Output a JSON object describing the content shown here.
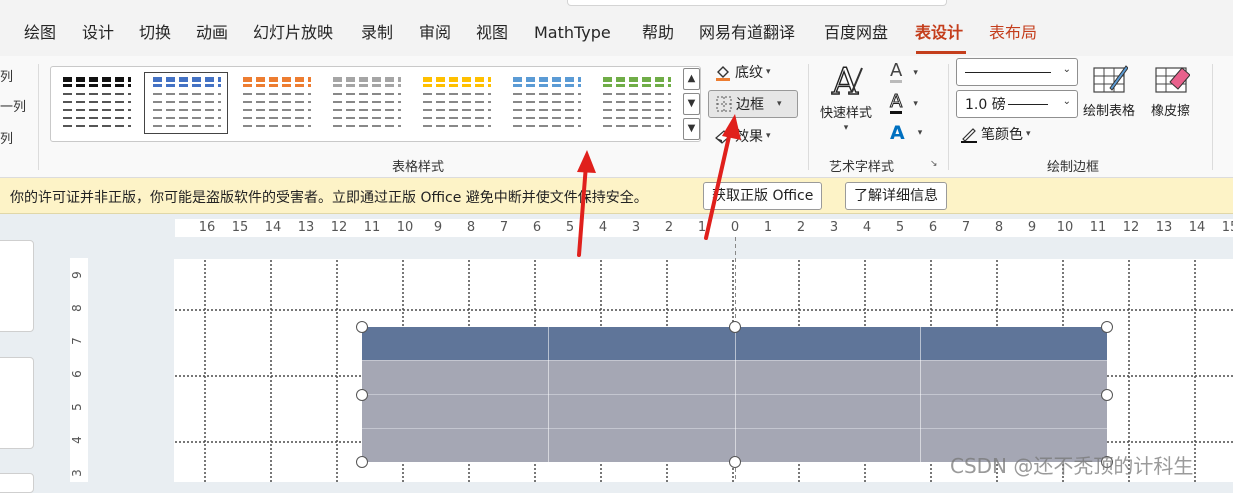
{
  "tabs": [
    {
      "label": "绘图"
    },
    {
      "label": "设计"
    },
    {
      "label": "切换"
    },
    {
      "label": "动画"
    },
    {
      "label": "幻灯片放映"
    },
    {
      "label": "录制"
    },
    {
      "label": "审阅"
    },
    {
      "label": "视图"
    },
    {
      "label": "MathType"
    },
    {
      "label": "帮助"
    },
    {
      "label": "网易有道翻译"
    },
    {
      "label": "百度网盘"
    },
    {
      "label": "表设计"
    },
    {
      "label": "表布局"
    }
  ],
  "left_fragments": [
    "列",
    "一列",
    "列"
  ],
  "table_styles": {
    "group_label": "表格样式",
    "colors": [
      "#111111",
      "#4472c4",
      "#ed7d31",
      "#a5a5a5",
      "#ffc000",
      "#5b9bd5",
      "#70ad47"
    ],
    "selected_index": 1
  },
  "shading": {
    "label": "底纹"
  },
  "borders": {
    "label": "边框"
  },
  "effects": {
    "label": "效果"
  },
  "wordart": {
    "quick_styles_label": "快速样式",
    "group_label": "艺术字样式",
    "text_fill_letter": "A",
    "accent_color": "#0070c0"
  },
  "draw_borders": {
    "group_label": "绘制边框",
    "pen_weight": "1.0 磅",
    "pen_color_label": "笔颜色",
    "draw_table_label": "绘制表格",
    "eraser_label": "橡皮擦"
  },
  "infobar": {
    "message": "你的许可证并非正版，你可能是盗版软件的受害者。立即通过正版 Office 避免中断并使文件保持安全。",
    "button_genuine": "获取正版 Office",
    "button_learn": "了解详细信息"
  },
  "hruler_labels": [
    "16",
    "15",
    "14",
    "13",
    "12",
    "11",
    "10",
    "9",
    "8",
    "7",
    "6",
    "5",
    "4",
    "3",
    "2",
    "1",
    "0",
    "1",
    "2",
    "3",
    "4",
    "5",
    "6",
    "7",
    "8",
    "9",
    "10",
    "11",
    "12",
    "13",
    "14",
    "15"
  ],
  "vruler_labels": [
    "9",
    "8",
    "7",
    "6",
    "5",
    "4",
    "3"
  ],
  "watermark": "CSDN @还不秃顶的计科生",
  "colors": {
    "accent_red": "#c43e1c",
    "header_row": "#5f7599",
    "body_rows": "#a5a7b4",
    "annotation_arrow": "#e0201c"
  }
}
